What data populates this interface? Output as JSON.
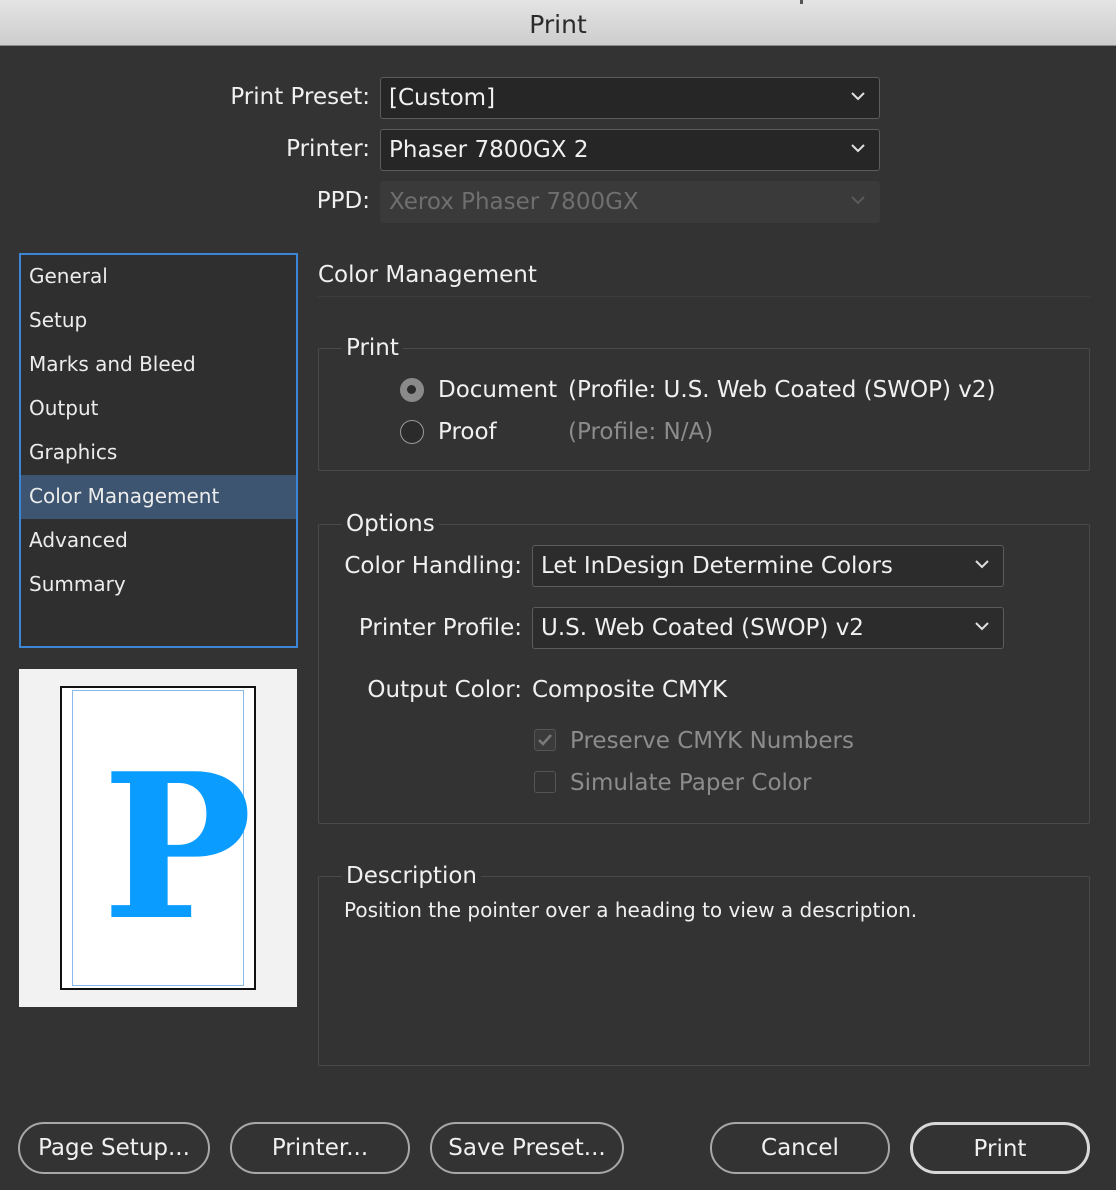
{
  "window": {
    "title": "Print"
  },
  "header": {
    "print_preset": {
      "label": "Print Preset:",
      "value": "[Custom]"
    },
    "printer": {
      "label": "Printer:",
      "value": "Phaser 7800GX 2"
    },
    "ppd": {
      "label": "PPD:",
      "value": "Xerox Phaser 7800GX"
    }
  },
  "sidebar": {
    "items": [
      {
        "label": "General"
      },
      {
        "label": "Setup"
      },
      {
        "label": "Marks and Bleed"
      },
      {
        "label": "Output"
      },
      {
        "label": "Graphics"
      },
      {
        "label": "Color Management",
        "selected": true
      },
      {
        "label": "Advanced"
      },
      {
        "label": "Summary"
      }
    ]
  },
  "preview": {
    "glyph": "P",
    "glyph_color": "#0a9cff"
  },
  "main": {
    "section_title": "Color Management",
    "print_group": {
      "title": "Print",
      "document": {
        "label": "Document",
        "profile": "(Profile: U.S. Web Coated (SWOP) v2)",
        "selected": true
      },
      "proof": {
        "label": "Proof",
        "profile": "(Profile: N/A)",
        "selected": false
      }
    },
    "options_group": {
      "title": "Options",
      "color_handling": {
        "label": "Color Handling:",
        "value": "Let InDesign Determine Colors"
      },
      "printer_profile": {
        "label": "Printer Profile:",
        "value": "U.S. Web Coated (SWOP) v2"
      },
      "output_color": {
        "label": "Output Color:",
        "value": "Composite CMYK"
      },
      "preserve_cmyk": {
        "label": "Preserve CMYK Numbers",
        "checked": true,
        "enabled": false
      },
      "simulate_paper": {
        "label": "Simulate Paper Color",
        "checked": false,
        "enabled": false
      }
    },
    "description": {
      "title": "Description",
      "text": "Position the pointer over a heading to view a description."
    }
  },
  "footer": {
    "page_setup": "Page Setup...",
    "printer": "Printer...",
    "save_preset": "Save Preset...",
    "cancel": "Cancel",
    "print": "Print"
  },
  "colors": {
    "accent": "#3d86d6",
    "selection": "#3d5570",
    "background": "#333333"
  }
}
